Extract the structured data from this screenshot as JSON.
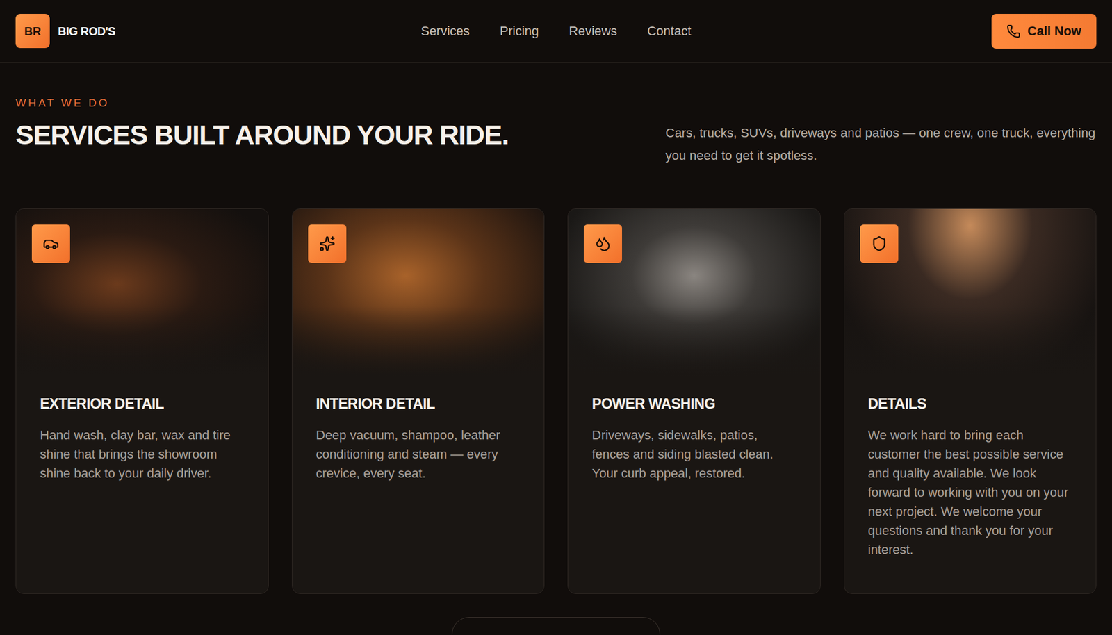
{
  "brand": {
    "initials": "BR",
    "name": "BIG ROD'S"
  },
  "nav": [
    "Services",
    "Pricing",
    "Reviews",
    "Contact"
  ],
  "call_button": "Call Now",
  "section": {
    "eyebrow": "WHAT WE DO",
    "title": "SERVICES BUILT AROUND YOUR RIDE.",
    "description": "Cars, trucks, SUVs, driveways and patios — one crew, one truck, everything you need to get it spotless."
  },
  "cards": [
    {
      "title": "EXTERIOR DETAIL",
      "text": "Hand wash, clay bar, wax and tire shine that brings the showroom shine back to your daily driver."
    },
    {
      "title": "INTERIOR DETAIL",
      "text": "Deep vacuum, shampoo, leather conditioning and steam — every crevice, every seat."
    },
    {
      "title": "POWER WASHING",
      "text": "Driveways, sidewalks, patios, fences and siding blasted clean. Your curb appeal, restored."
    },
    {
      "title": "DETAILS",
      "text": "We work hard to bring each customer the best possible service and quality available. We look forward to working with you on your next project. We welcome your questions and thank you for your interest."
    }
  ]
}
